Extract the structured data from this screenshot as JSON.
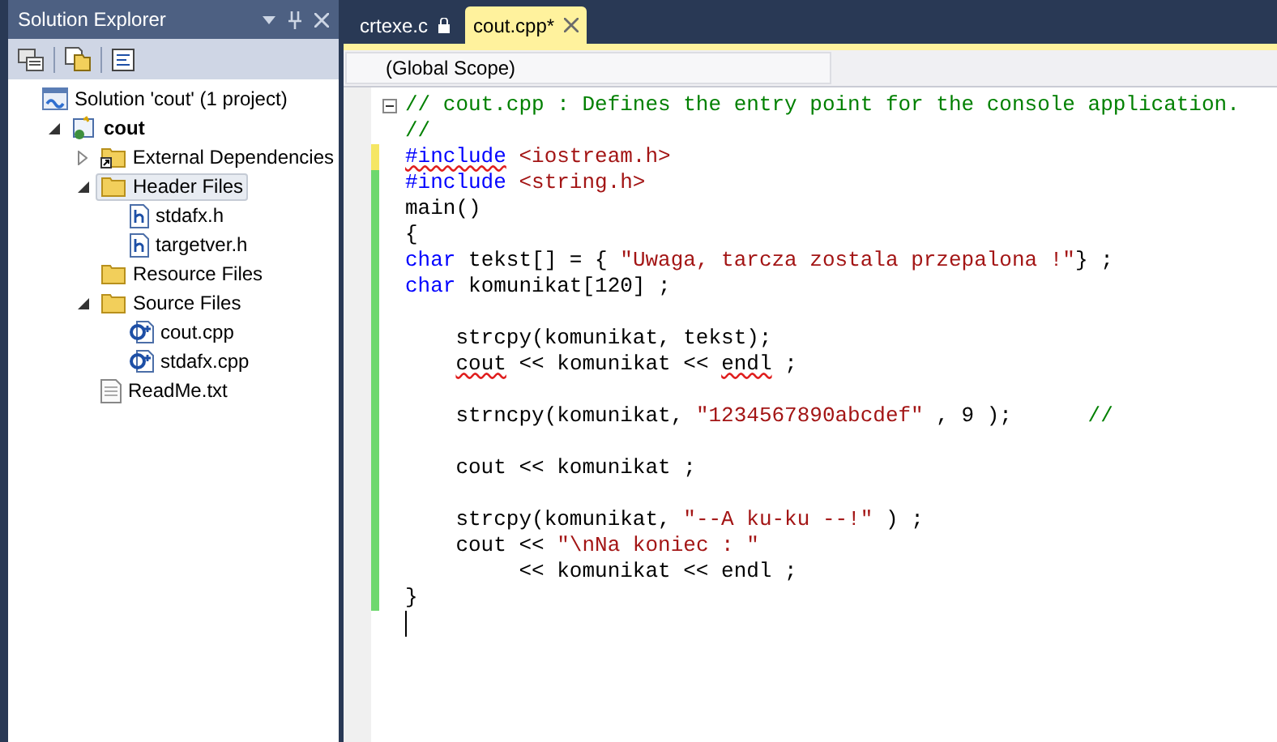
{
  "solution_explorer": {
    "title": "Solution Explorer",
    "tree": [
      {
        "label": "Solution 'cout' (1 project)",
        "kind": "solution",
        "selected": false,
        "children": [
          {
            "label": "cout",
            "kind": "project",
            "selected": false,
            "expanded": true,
            "children": [
              {
                "label": "External Dependencies",
                "kind": "references",
                "selected": false,
                "expanded": false
              },
              {
                "label": "Header Files",
                "kind": "folder",
                "selected": true,
                "expanded": true,
                "children": [
                  {
                    "label": "stdafx.h",
                    "kind": "header",
                    "selected": false
                  },
                  {
                    "label": "targetver.h",
                    "kind": "header",
                    "selected": false
                  }
                ]
              },
              {
                "label": "Resource Files",
                "kind": "folder",
                "selected": false
              },
              {
                "label": "Source Files",
                "kind": "folder",
                "selected": false,
                "expanded": true,
                "children": [
                  {
                    "label": "cout.cpp",
                    "kind": "cpp",
                    "selected": false
                  },
                  {
                    "label": "stdafx.cpp",
                    "kind": "cpp",
                    "selected": false
                  }
                ]
              },
              {
                "label": "ReadMe.txt",
                "kind": "text",
                "selected": false
              }
            ]
          }
        ]
      }
    ]
  },
  "tabs": [
    {
      "label": "crtexe.c",
      "selected": false,
      "locked": true
    },
    {
      "label": "cout.cpp*",
      "selected": true,
      "locked": false
    }
  ],
  "scope": "(Global Scope)",
  "code": [
    {
      "modified": false,
      "fold": true,
      "tokens": [
        {
          "text": "// cout.cpp : Defines the entry point for the console application.",
          "kind": "comment"
        }
      ]
    },
    {
      "modified": false,
      "tokens": [
        {
          "text": "//",
          "kind": "comment"
        }
      ]
    },
    {
      "modified": true,
      "saved": false,
      "tokens": [
        {
          "text": "#include",
          "kind": "keyword",
          "squiggle": true
        },
        {
          "text": " <iostream.h>",
          "kind": "string"
        }
      ]
    },
    {
      "modified": true,
      "saved": true,
      "tokens": [
        {
          "text": "#include",
          "kind": "keyword"
        },
        {
          "text": " <string.h>",
          "kind": "string"
        }
      ]
    },
    {
      "modified": true,
      "saved": true,
      "tokens": [
        {
          "text": "main()",
          "kind": "plain"
        }
      ]
    },
    {
      "modified": true,
      "saved": true,
      "tokens": [
        {
          "text": "{",
          "kind": "plain"
        }
      ]
    },
    {
      "modified": true,
      "saved": true,
      "tokens": [
        {
          "text": "char",
          "kind": "keyword"
        },
        {
          "text": " tekst[] = { ",
          "kind": "plain"
        },
        {
          "text": "\"Uwaga, tarcza zostala przepalona !\"",
          "kind": "string"
        },
        {
          "text": "} ;",
          "kind": "plain"
        }
      ]
    },
    {
      "modified": true,
      "saved": true,
      "tokens": [
        {
          "text": "char",
          "kind": "keyword"
        },
        {
          "text": " komunikat[120] ;",
          "kind": "plain"
        }
      ]
    },
    {
      "modified": true,
      "saved": true
    },
    {
      "modified": true,
      "saved": true,
      "tokens": [
        {
          "text": "    strcpy(komunikat, tekst);",
          "kind": "plain"
        }
      ]
    },
    {
      "modified": true,
      "saved": true,
      "tokens": [
        {
          "text": "    cout",
          "kind": "plain",
          "squiggle": true
        },
        {
          "text": " << komunikat << ",
          "kind": "plain"
        },
        {
          "text": "endl",
          "kind": "plain",
          "squiggle": true
        },
        {
          "text": " ;",
          "kind": "plain"
        }
      ]
    },
    {
      "modified": true,
      "saved": true
    },
    {
      "modified": true,
      "saved": true,
      "tokens": [
        {
          "text": "    strncpy(komunikat, ",
          "kind": "plain"
        },
        {
          "text": "\"1234567890abcdef\"",
          "kind": "string"
        },
        {
          "text": " , 9 );      ",
          "kind": "plain"
        },
        {
          "text": "//",
          "kind": "comment"
        }
      ]
    },
    {
      "modified": true,
      "saved": true
    },
    {
      "modified": true,
      "saved": true,
      "tokens": [
        {
          "text": "    cout << komunikat ;",
          "kind": "plain"
        }
      ]
    },
    {
      "modified": true,
      "saved": true
    },
    {
      "modified": true,
      "saved": true,
      "tokens": [
        {
          "text": "    strcpy(komunikat, ",
          "kind": "plain"
        },
        {
          "text": "\"--A ku-ku --!\"",
          "kind": "string"
        },
        {
          "text": " ) ;",
          "kind": "plain"
        }
      ]
    },
    {
      "modified": true,
      "saved": true,
      "tokens": [
        {
          "text": "    cout << ",
          "kind": "plain"
        },
        {
          "text": "\"\\nNa koniec : \"",
          "kind": "string"
        }
      ]
    },
    {
      "modified": true,
      "saved": true,
      "tokens": [
        {
          "text": "         << komunikat << endl ;",
          "kind": "plain"
        }
      ]
    },
    {
      "modified": true,
      "saved": true,
      "tokens": [
        {
          "text": "}",
          "kind": "plain"
        }
      ]
    },
    {
      "modified": false,
      "cursor": true
    }
  ]
}
